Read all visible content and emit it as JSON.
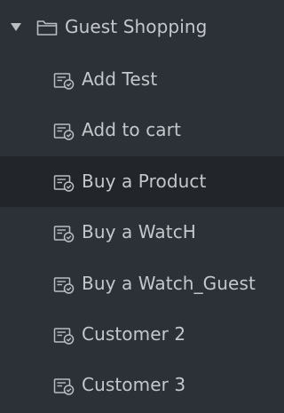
{
  "tree": {
    "folder": {
      "label": "Guest Shopping",
      "expanded": true,
      "icon": "folder-open-icon"
    },
    "items": [
      {
        "label": "Add Test",
        "icon": "test-case-icon",
        "selected": false
      },
      {
        "label": "Add to cart",
        "icon": "test-case-icon",
        "selected": false
      },
      {
        "label": "Buy a Product",
        "icon": "test-case-icon",
        "selected": true
      },
      {
        "label": "Buy a WatcH",
        "icon": "test-case-icon",
        "selected": false
      },
      {
        "label": "Buy a Watch_Guest",
        "icon": "test-case-icon",
        "selected": false
      },
      {
        "label": "Customer 2",
        "icon": "test-case-icon",
        "selected": false
      },
      {
        "label": "Customer 3",
        "icon": "test-case-icon",
        "selected": false
      }
    ]
  },
  "colors": {
    "background": "#2c3137",
    "selected_background": "#22262b",
    "text": "#c4c8cc",
    "icon": "#b9bec3"
  }
}
